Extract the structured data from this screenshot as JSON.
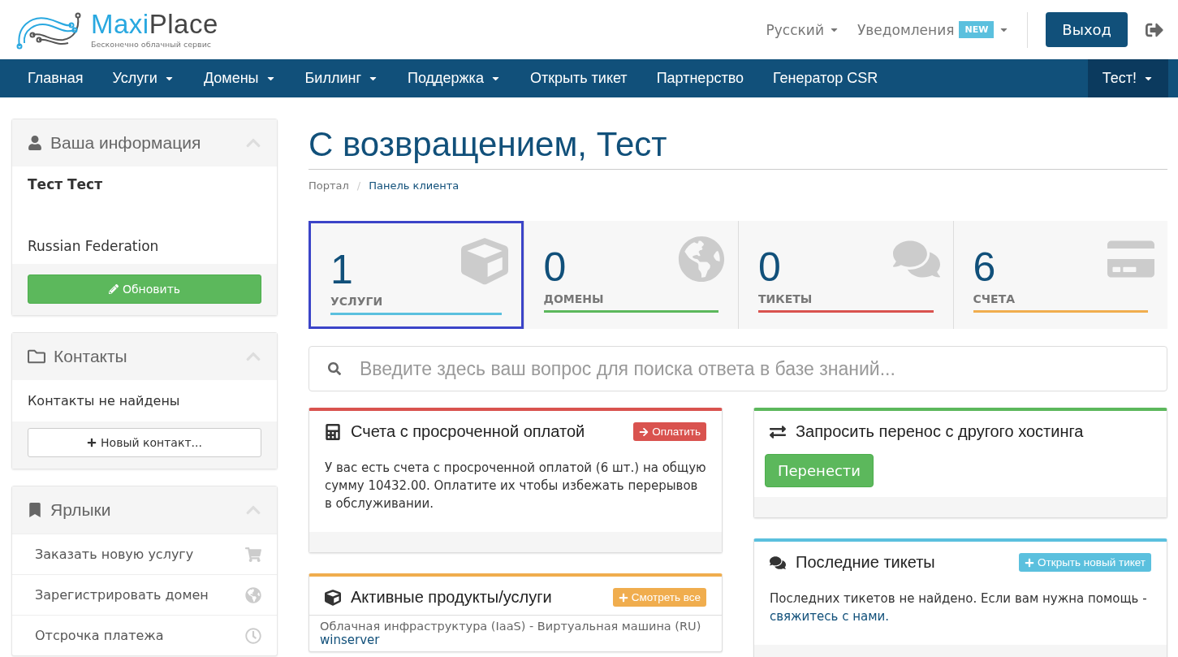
{
  "header": {
    "brand": [
      "Maxi",
      "Place"
    ],
    "tagline": "Бесконечно облачный сервис",
    "language": "Русский",
    "notifications": {
      "label": "Уведомления",
      "badge": "NEW"
    },
    "logout_button": "Выход"
  },
  "nav": {
    "items": [
      {
        "label": "Главная",
        "dropdown": false
      },
      {
        "label": "Услуги",
        "dropdown": true
      },
      {
        "label": "Домены",
        "dropdown": true
      },
      {
        "label": "Биллинг",
        "dropdown": true
      },
      {
        "label": "Поддержка",
        "dropdown": true
      },
      {
        "label": "Открыть тикет",
        "dropdown": false
      },
      {
        "label": "Партнерство",
        "dropdown": false
      },
      {
        "label": "Генератор CSR",
        "dropdown": false
      }
    ],
    "account": {
      "label": "Тест!",
      "dropdown": true
    }
  },
  "sidebar": [
    {
      "kind": "info",
      "title": "Ваша информация",
      "name": "Тест Тест",
      "country": "Russian Federation",
      "button": "Обновить"
    },
    {
      "kind": "contacts",
      "title": "Контакты",
      "text": "Контакты не найдены",
      "button": "Новый контакт..."
    },
    {
      "kind": "shortcuts",
      "title": "Ярлыки",
      "items": [
        {
          "label": "Заказать новую услугу"
        },
        {
          "label": "Зарегистрировать домен"
        },
        {
          "label": "Отсрочка платежа"
        }
      ]
    }
  ],
  "title": "С возвращением, Тест",
  "breadcrumb": {
    "separator": "/",
    "items": [
      {
        "label": "Портал",
        "selected": false
      },
      {
        "label": "Панель клиента",
        "selected": true
      }
    ]
  },
  "stats": [
    {
      "count": "1",
      "label": "УСЛУГИ",
      "color": "#5bc0de",
      "selected": true
    },
    {
      "count": "0",
      "label": "ДОМЕНЫ",
      "color": "#5cb85c",
      "selected": false
    },
    {
      "count": "0",
      "label": "ТИКЕТЫ",
      "color": "#d9534f",
      "selected": false
    },
    {
      "count": "6",
      "label": "СЧЕТА",
      "color": "#f0ad4e",
      "selected": false
    }
  ],
  "search": {
    "placeholder": "Введите здесь ваш вопрос для поиска ответа в базе знаний..."
  },
  "columns": [
    [
      {
        "kind": "text",
        "title": "Счета с просроченной оплатой",
        "color": "#d9534f",
        "button": "Оплатить",
        "text": "У вас есть счета с просроченной оплатой (6 шт.) на общую сумму 10432.00. Оплатите их чтобы избежать перерывов в обслуживании."
      },
      {
        "kind": "list",
        "title": "Активные продукты/услуги",
        "color": "#f0ad4e",
        "button": "Смотреть все",
        "rows": [
          {
            "product": "Облачная инфраструктура (IaaS) - Виртуальная машина (RU)",
            "link": "winserver"
          }
        ]
      }
    ],
    [
      {
        "kind": "action",
        "title": "Запросить перенос с другого хостинга",
        "color": "#5cb85c",
        "action": "Перенести"
      },
      {
        "kind": "text",
        "title": "Последние тикеты",
        "color": "#5bc0de",
        "button": "Открыть новый тикет",
        "text": "Последних тикетов не найдено. Если вам нужна помощь -",
        "link": "свяжитесь с нами."
      }
    ]
  ]
}
